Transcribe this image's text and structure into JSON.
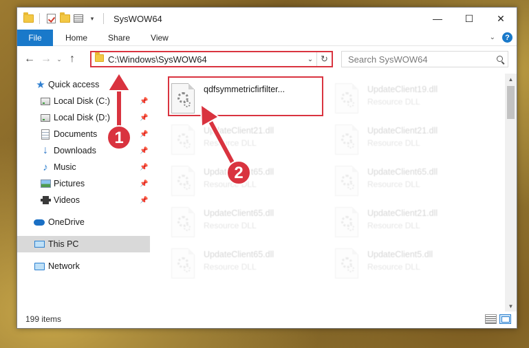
{
  "window": {
    "title": "SysWOW64",
    "controls": {
      "minimize": "—",
      "maximize": "☐",
      "close": "✕"
    }
  },
  "ribbon": {
    "file": "File",
    "tabs": [
      "Home",
      "Share",
      "View"
    ],
    "collapse": "⌄",
    "help": "?"
  },
  "nav": {
    "back": "←",
    "forward": "→",
    "recent": "⌄",
    "up": "↑",
    "address": "C:\\Windows\\SysWOW64",
    "address_drop": "⌄",
    "refresh": "↻",
    "search_placeholder": "Search SysWOW64"
  },
  "sidebar": {
    "items": [
      {
        "label": "Quick access",
        "icon": "star-icon",
        "pinned": false
      },
      {
        "label": "Local Disk (C:)",
        "icon": "drive-icon",
        "pinned": true
      },
      {
        "label": "Local Disk (D:)",
        "icon": "drive-icon",
        "pinned": true
      },
      {
        "label": "Documents",
        "icon": "documents-icon",
        "pinned": true
      },
      {
        "label": "Downloads",
        "icon": "download-icon",
        "pinned": true
      },
      {
        "label": "Music",
        "icon": "music-icon",
        "pinned": true
      },
      {
        "label": "Pictures",
        "icon": "pictures-icon",
        "pinned": true
      },
      {
        "label": "Videos",
        "icon": "videos-icon",
        "pinned": true
      },
      {
        "label": "OneDrive",
        "icon": "onedrive-icon",
        "pinned": false
      },
      {
        "label": "This PC",
        "icon": "this-pc-icon",
        "pinned": false,
        "selected": true
      },
      {
        "label": "Network",
        "icon": "network-icon",
        "pinned": false
      }
    ],
    "pin_glyph": "📌"
  },
  "files": [
    {
      "name": "qdfsymmetricfirfilter...",
      "type": "",
      "highlighted": true
    },
    {
      "name": "UpdateClient19.dll",
      "type": "Resource DLL"
    },
    {
      "name": "UpdateClient21.dll",
      "type": "Resource DLL"
    },
    {
      "name": "UpdateClient21.dll",
      "type": "Resource DLL"
    },
    {
      "name": "UpdateClient65.dll",
      "type": "Resource DLL"
    },
    {
      "name": "UpdateClient65.dll",
      "type": "Resource DLL"
    },
    {
      "name": "UpdateClient65.dll",
      "type": "Resource DLL"
    },
    {
      "name": "UpdateClient21.dll",
      "type": "Resource DLL"
    },
    {
      "name": "UpdateClient65.dll",
      "type": "Resource DLL"
    },
    {
      "name": "UpdateClient5.dll",
      "type": "Resource DLL"
    }
  ],
  "status": {
    "count": "199 items"
  },
  "annotations": {
    "step1": "1",
    "step2": "2",
    "color": "#d9333f"
  }
}
